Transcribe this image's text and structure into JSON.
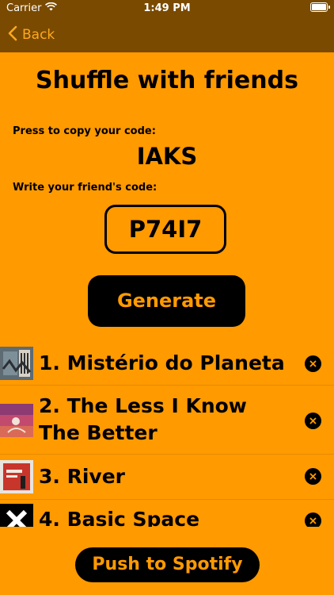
{
  "status_bar": {
    "carrier": "Carrier",
    "time": "1:49 PM"
  },
  "nav": {
    "back_label": "Back"
  },
  "title": "Shuffle with friends",
  "copy_label": "Press to copy your code:",
  "my_code": "IAKS",
  "friend_label": "Write your friend's code:",
  "friend_code": "P74I7",
  "generate_label": "Generate",
  "songs": [
    {
      "title": "1. Mistério do Planeta"
    },
    {
      "title": "2. The Less I Know The Better"
    },
    {
      "title": "3. River"
    },
    {
      "title": "4. Basic Space"
    }
  ],
  "push_label": "Push to Spotify",
  "colors": {
    "background": "#FF9A00",
    "bar": "#7A4A00",
    "accent": "#FFA81E",
    "dark": "#000000"
  }
}
